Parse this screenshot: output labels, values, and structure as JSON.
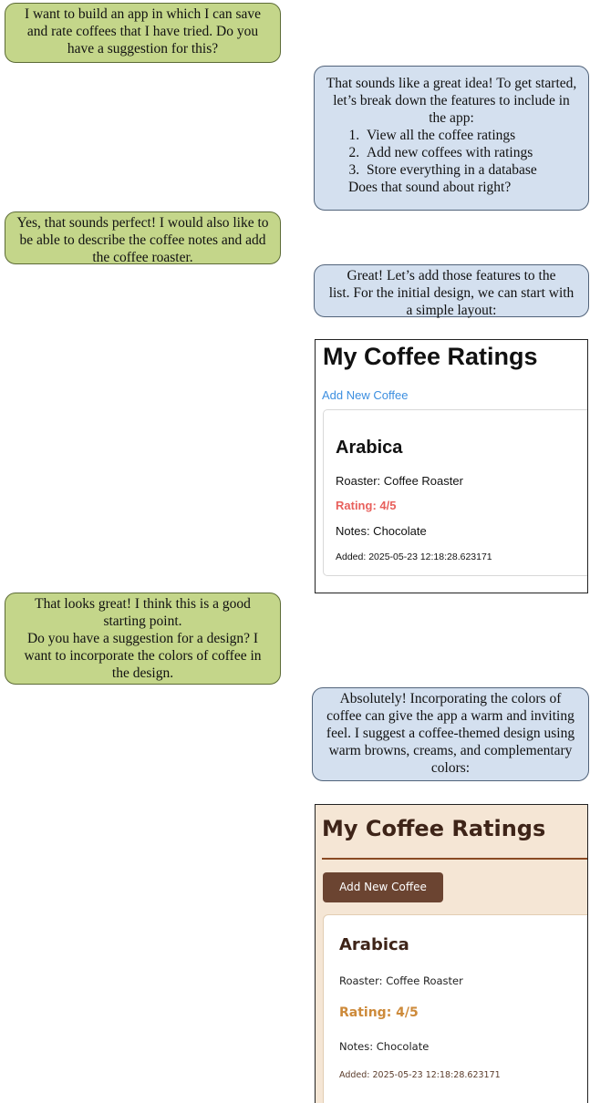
{
  "messages": {
    "m1": {
      "line1": "I want to build an app in which I can save",
      "line2": "and rate coffees that I have tried. Do you",
      "line3": "have a suggestion for this?"
    },
    "m2": {
      "line1": "That sounds like a great idea! To get started,",
      "line2": "let’s break down the features to include in",
      "line3": "the app:",
      "items": [
        "View all the coffee ratings",
        "Add new coffees with ratings",
        "Store everything in a database"
      ],
      "tail": "Does that sound about right?"
    },
    "m3": {
      "line1": "Yes, that sounds perfect! I would also like to",
      "line2": "be able to describe the coffee notes and add",
      "line3": "the coffee roaster."
    },
    "m4": {
      "line1": "Great! Let’s add those features to the",
      "line2": "list. For the initial design, we can start with",
      "line3": "a simple layout:"
    },
    "m5": {
      "line1": "That looks great! I think this is a good",
      "line2": "starting point.",
      "line3": "Do you have a suggestion for a design? I",
      "line4": "want to incorporate the colors of coffee in",
      "line5": "the design."
    },
    "m6": {
      "line1": "Absolutely! Incorporating the colors of",
      "line2": "coffee can give the app a warm and inviting",
      "line3": "feel. I suggest a coffee-themed design using",
      "line4": "warm browns, creams, and complementary",
      "line5": "colors:"
    }
  },
  "mockup_simple": {
    "title": "My Coffee Ratings",
    "add_link": "Add New Coffee",
    "coffee": {
      "name": "Arabica",
      "roaster": "Roaster: Coffee Roaster",
      "rating": "Rating: 4/5",
      "notes": "Notes: Chocolate",
      "added": "Added: 2025-05-23 12:18:28.623171"
    }
  },
  "mockup_themed": {
    "title": "My Coffee Ratings",
    "add_button": "Add New Coffee",
    "coffee": {
      "name": "Arabica",
      "roaster": "Roaster: Coffee Roaster",
      "rating": "Rating: 4/5",
      "notes": "Notes: Chocolate",
      "added": "Added: 2025-05-23 12:18:28.623171"
    }
  },
  "colors": {
    "user_bubble": "#c4d68a",
    "assistant_bubble": "#d4e0ef",
    "link_blue": "#3d8fe0",
    "rating_red": "#e8605c",
    "cream": "#f5e6d5",
    "coffee_brown": "#6b4431",
    "rating_caramel": "#cd8a3a"
  }
}
